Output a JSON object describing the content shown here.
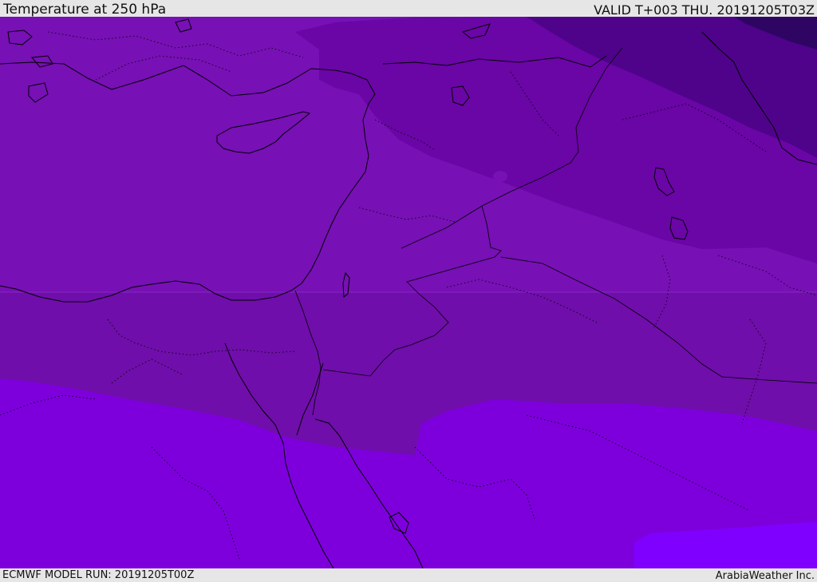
{
  "header": {
    "title": "Temperature at 250 hPa",
    "valid_time": "VALID T+003 THU. 20191205T03Z"
  },
  "footer": {
    "model_run": "ECMWF MODEL RUN: 20191205T00Z",
    "credit": "ArabiaWeather Inc."
  },
  "map": {
    "field": "temperature",
    "level": "250 hPa",
    "bands": [
      {
        "name": "darkest-northeast",
        "color": "#2e0563"
      },
      {
        "name": "very-cold",
        "color": "#4e038a"
      },
      {
        "name": "cold",
        "color": "#6a05a6"
      },
      {
        "name": "cool",
        "color": "#7710b5"
      },
      {
        "name": "mid",
        "color": "#6f0eaa"
      },
      {
        "name": "warm",
        "color": "#7d00dc"
      },
      {
        "name": "warmest-southeast",
        "color": "#7f00ff"
      }
    ],
    "coastline_color": "#000000",
    "border_style": "dotted"
  }
}
